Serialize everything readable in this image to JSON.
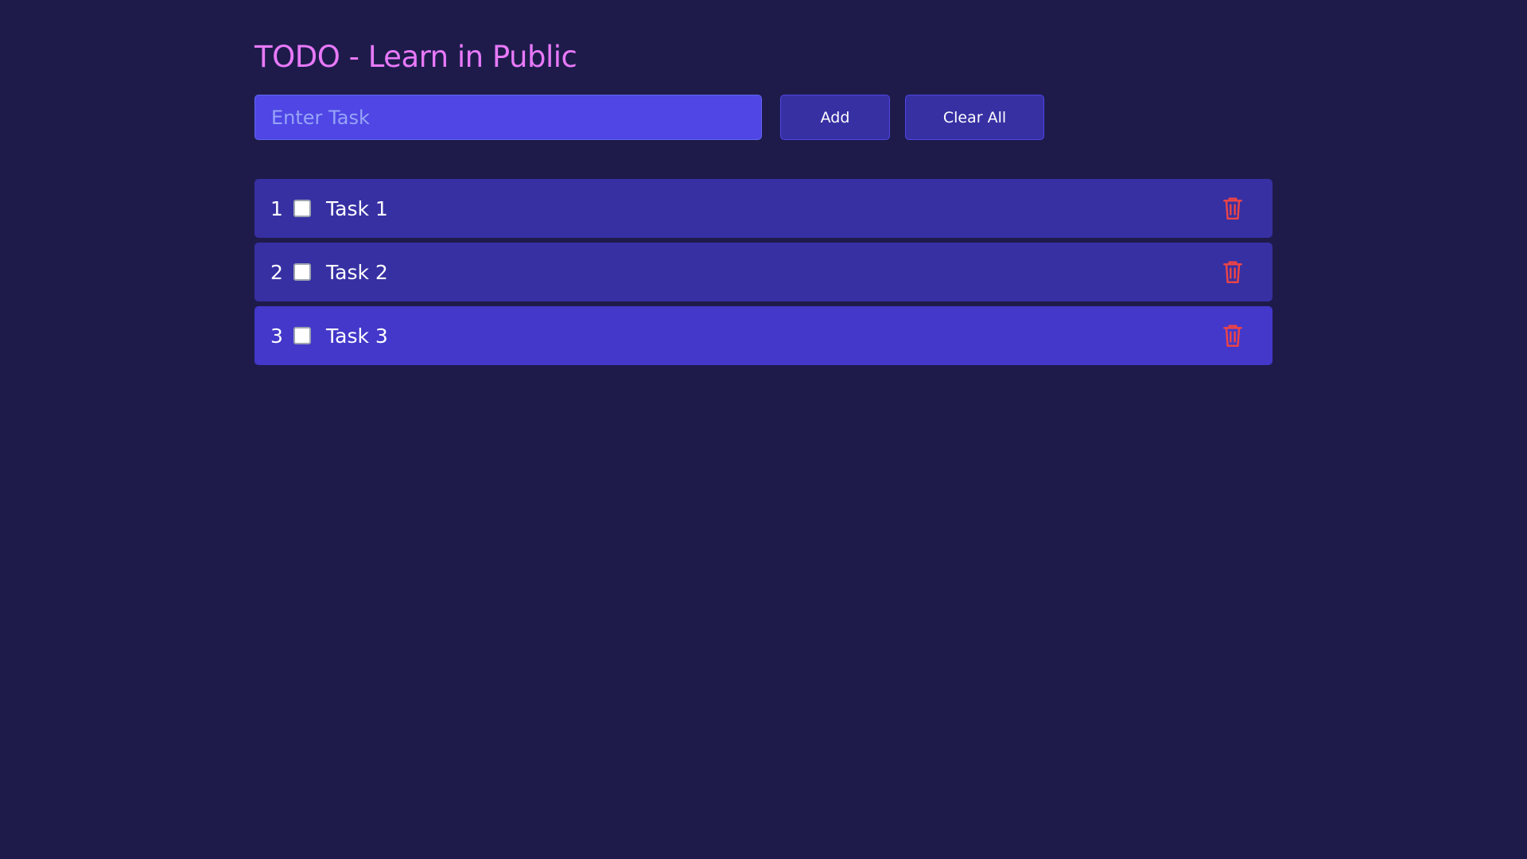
{
  "header": {
    "title": "TODO - Learn in Public"
  },
  "form": {
    "input_placeholder": "Enter Task",
    "input_value": "",
    "add_label": "Add",
    "clear_label": "Clear All"
  },
  "tasks": [
    {
      "number": "1",
      "text": "Task 1",
      "checked": false,
      "delete_icon": "trash-icon"
    },
    {
      "number": "2",
      "text": "Task 2",
      "checked": false,
      "delete_icon": "trash-icon"
    },
    {
      "number": "3",
      "text": "Task 3",
      "checked": false,
      "delete_icon": "trash-icon"
    }
  ],
  "colors": {
    "background": "#1e1b4b",
    "title": "#e879f9",
    "input_bg": "#4f46e5",
    "button_bg": "#3730a3",
    "task_bg": "#3730a3",
    "task_highlight_bg": "#4338ca",
    "delete_icon": "#ef4444"
  }
}
